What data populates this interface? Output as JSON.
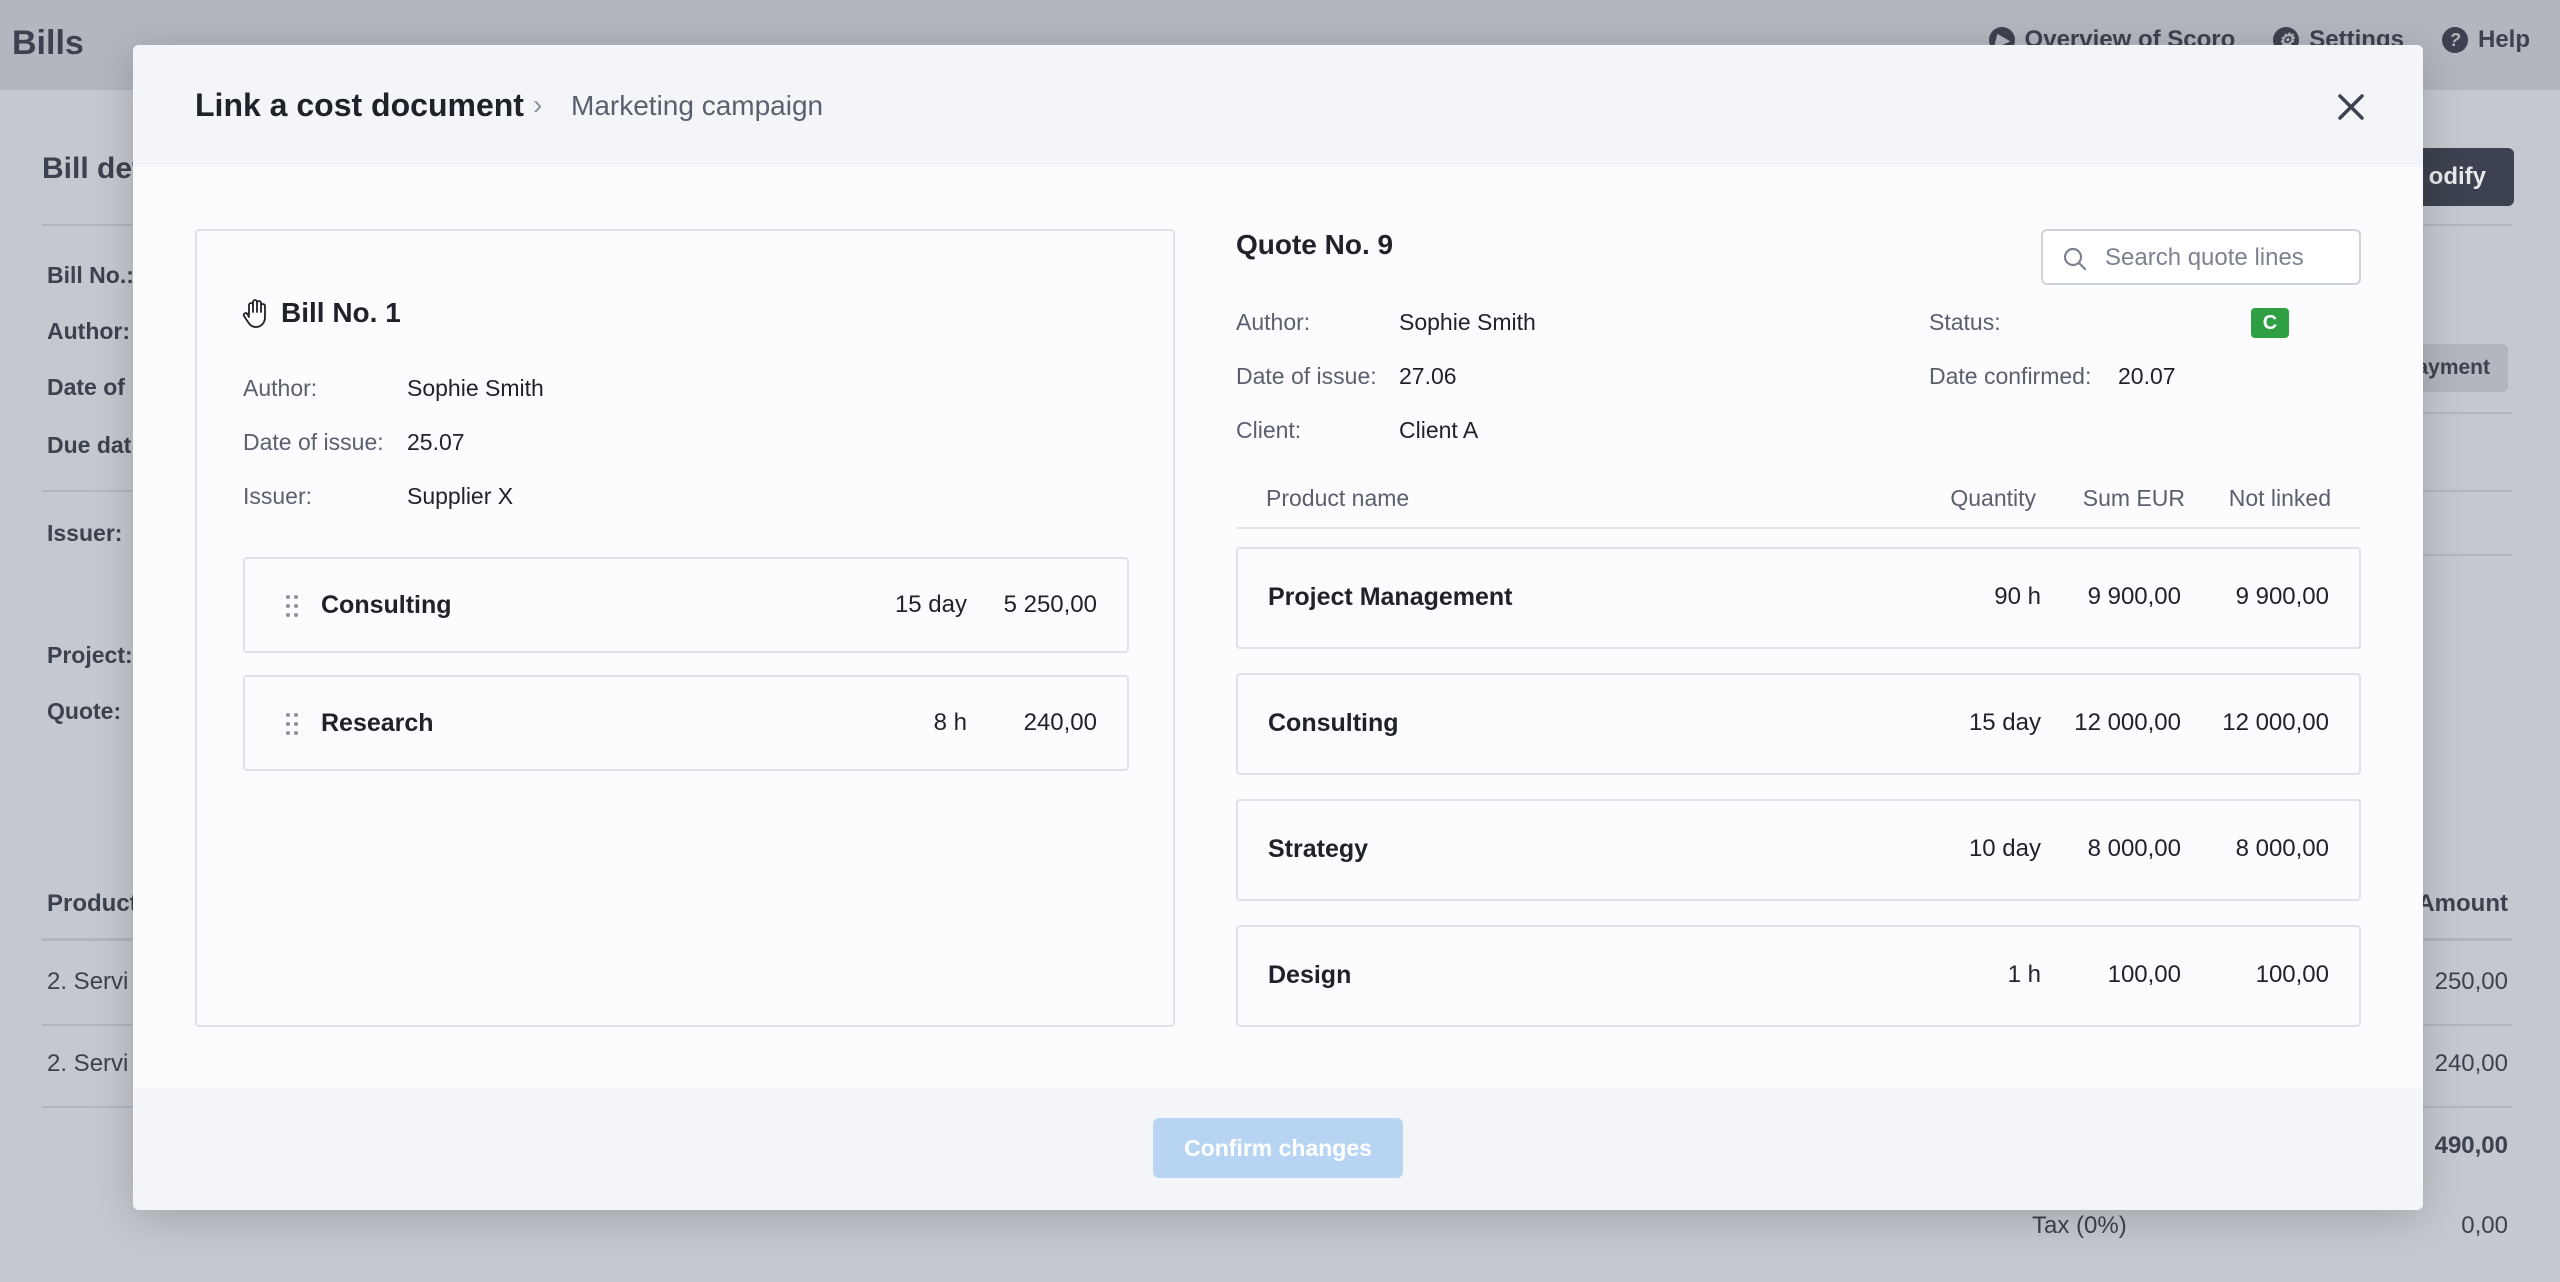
{
  "background": {
    "app_title": "Bills",
    "top_links": [
      "Overview of Scoro",
      "Settings",
      "Help"
    ],
    "section_title": "Bill det",
    "modify_label": "odify",
    "payment_label": "ayment",
    "labels": [
      "Bill No.:",
      "Author:",
      "Date of",
      "Due dat",
      "Issuer:",
      "Project:",
      "Quote:"
    ],
    "table": {
      "col_product": "Product",
      "col_amount": "Amount",
      "rows": [
        {
          "name": "2. Servi",
          "amount": "250,00"
        },
        {
          "name": "2. Servi",
          "amount": "240,00"
        }
      ],
      "total": "490,00",
      "tax_label": "Tax (0%)",
      "tax_value": "0,00"
    }
  },
  "modal": {
    "title": "Link a cost document",
    "breadcrumb_sep": "›",
    "subtitle": "Marketing campaign",
    "confirm_label": "Confirm changes"
  },
  "bill": {
    "title": "Bill No. 1",
    "author_label": "Author:",
    "author": "Sophie Smith",
    "date_label": "Date of issue:",
    "date": "25.07",
    "issuer_label": "Issuer:",
    "issuer": "Supplier X",
    "lines": [
      {
        "name": "Consulting",
        "qty": "15 day",
        "sum": "5 250,00"
      },
      {
        "name": "Research",
        "qty": "8 h",
        "sum": "240,00"
      }
    ]
  },
  "quote": {
    "title": "Quote No. 9",
    "search_placeholder": "Search quote lines",
    "author_label": "Author:",
    "author": "Sophie Smith",
    "date_label": "Date of issue:",
    "date": "27.06",
    "client_label": "Client:",
    "client": "Client A",
    "status_label": "Status:",
    "status": "C",
    "status_color": "#2ea043",
    "confirmed_label": "Date confirmed:",
    "confirmed": "20.07",
    "columns": [
      "Product name",
      "Quantity",
      "Sum EUR",
      "Not linked"
    ],
    "lines": [
      {
        "name": "Project Management",
        "qty": "90 h",
        "sum": "9 900,00",
        "not_linked": "9 900,00"
      },
      {
        "name": "Consulting",
        "qty": "15 day",
        "sum": "12 000,00",
        "not_linked": "12 000,00"
      },
      {
        "name": "Strategy",
        "qty": "10 day",
        "sum": "8 000,00",
        "not_linked": "8 000,00"
      },
      {
        "name": "Design",
        "qty": "1 h",
        "sum": "100,00",
        "not_linked": "100,00"
      }
    ]
  },
  "colors": {
    "accent_disabled": "#b7d5f3",
    "status_green": "#2ea043"
  }
}
